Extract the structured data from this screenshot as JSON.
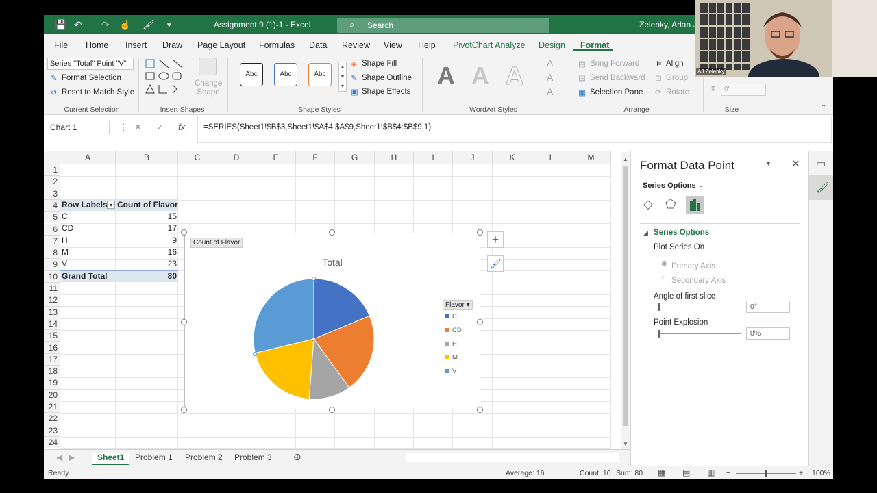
{
  "titlebar": {
    "title": "Assignment 9 (1)-1  -  Excel",
    "search_placeholder": "Search",
    "user": "Zelenky, Arlan J."
  },
  "tabs": [
    "File",
    "Home",
    "Insert",
    "Draw",
    "Page Layout",
    "Formulas",
    "Data",
    "Review",
    "View",
    "Help",
    "PivotChart Analyze",
    "Design",
    "Format"
  ],
  "ribbon": {
    "current_selection": {
      "selector_value": "Series \"Total\" Point \"V\"",
      "format_selection": "Format Selection",
      "reset_style": "Reset to Match Style",
      "label": "Current Selection"
    },
    "insert_shapes": {
      "change_shape": "Change Shape",
      "label": "Insert Shapes"
    },
    "shape_styles": {
      "preset": "Abc",
      "fill": "Shape Fill",
      "outline": "Shape Outline",
      "effects": "Shape Effects",
      "label": "Shape Styles"
    },
    "wordart": {
      "letter": "A",
      "label": "WordArt Styles"
    },
    "arrange": {
      "bring_forward": "Bring Forward",
      "send_backward": "Send Backward",
      "selection_pane": "Selection Pane",
      "align": "Align",
      "group": "Group",
      "rotate": "Rotate",
      "label": "Arrange"
    },
    "size": {
      "height_value": "0\"",
      "label": "Size"
    }
  },
  "formula_bar": {
    "name_box": "Chart 1",
    "formula": "=SERIES(Sheet1!$B$3,Sheet1!$A$4:$A$9,Sheet1!$B$4:$B$9,1)"
  },
  "columns": [
    "A",
    "B",
    "C",
    "D",
    "E",
    "F",
    "G",
    "H",
    "I",
    "J",
    "K",
    "L",
    "M"
  ],
  "rows": [
    "1",
    "2",
    "3",
    "4",
    "5",
    "6",
    "7",
    "8",
    "9",
    "10",
    "11",
    "12",
    "13",
    "14",
    "15",
    "16",
    "17",
    "18",
    "19",
    "20",
    "21",
    "22",
    "23",
    "24"
  ],
  "pivot": {
    "header_row_labels": "Row Labels",
    "header_count": "Count of Flavor",
    "rows": [
      {
        "label": "C",
        "value": "15"
      },
      {
        "label": "CD",
        "value": "17"
      },
      {
        "label": "H",
        "value": "9"
      },
      {
        "label": "M",
        "value": "16"
      },
      {
        "label": "V",
        "value": "23"
      }
    ],
    "total_label": "Grand Total",
    "total_value": "80"
  },
  "chart_data": {
    "type": "pie",
    "title": "Total",
    "field_button": "Count of Flavor",
    "legend_title": "Flavor",
    "legend_position": "right",
    "categories": [
      "C",
      "CD",
      "H",
      "M",
      "V"
    ],
    "values": [
      15,
      17,
      9,
      16,
      23
    ],
    "colors": [
      "#4472c4",
      "#ed7d31",
      "#a5a5a5",
      "#ffc000",
      "#5b9bd5"
    ]
  },
  "sheet_tabs": [
    "Sheet1",
    "Problem 1",
    "Problem 2",
    "Problem 3"
  ],
  "status": {
    "mode": "Ready",
    "average": "Average: 16",
    "count": "Count: 10",
    "sum": "Sum: 80",
    "zoom": "100%"
  },
  "format_pane": {
    "title": "Format Data Point",
    "dropdown": "Series Options",
    "section": "Series Options",
    "plot_series_on": "Plot Series On",
    "primary_axis": "Primary Axis",
    "secondary_axis": "Secondary Axis",
    "angle_label": "Angle of first slice",
    "angle_value": "0°",
    "explosion_label": "Point Explosion",
    "explosion_value": "0%"
  },
  "webcam": {
    "name": "AJ Zelenky"
  },
  "accent": "#217346"
}
